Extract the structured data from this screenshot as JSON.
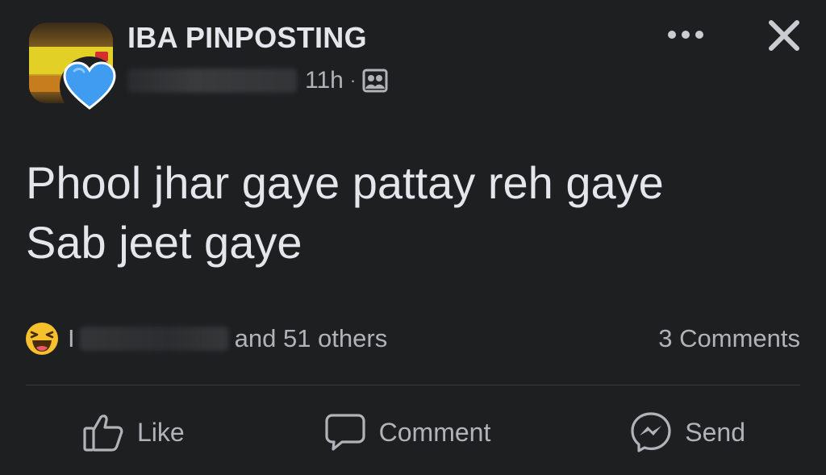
{
  "header": {
    "group_name": "IBA PINPOSTING",
    "time": "11h",
    "separator": "·",
    "privacy_icon": "group-members-icon",
    "more_icon": "more-horizontal-icon",
    "close_icon": "close-icon"
  },
  "post": {
    "lines": [
      "Phool jhar gaye pattay reh gaye",
      "Sab jeet gaye"
    ]
  },
  "reactions": {
    "emoji": "haha-reaction-icon",
    "initial": "I",
    "summary": "and 51 others",
    "comments": "3 Comments"
  },
  "actions": [
    {
      "label": "Like",
      "icon": "thumbs-up-icon"
    },
    {
      "label": "Comment",
      "icon": "comment-bubble-icon"
    },
    {
      "label": "Send",
      "icon": "messenger-icon"
    }
  ],
  "colors": {
    "background": "#1e1f21",
    "primary_text": "#e4e6eb",
    "secondary_text": "#b0b3b8",
    "heart_blue": "#3f9cf0",
    "haha_yellow": "#f7c12e"
  }
}
